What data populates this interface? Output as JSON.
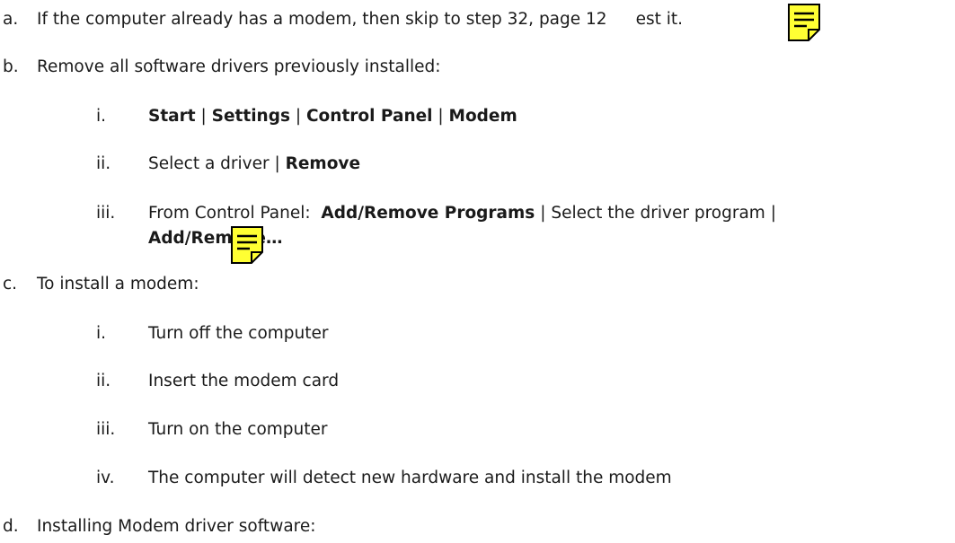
{
  "items": {
    "a": {
      "marker": "a.",
      "text_before": "If the computer already has a modem, then skip to step 32, page 12",
      "text_after": "est it."
    },
    "b": {
      "marker": "b.",
      "text": "Remove all software drivers previously installed:",
      "sub": {
        "i": {
          "marker": "i.",
          "start": "Start",
          "sep": "|",
          "settings": "Settings",
          "control_panel": "Control Panel",
          "modem": "Modem"
        },
        "ii": {
          "marker": "ii.",
          "text": "Select a driver",
          "sep": "|",
          "remove": "Remove"
        },
        "iii": {
          "marker": "iii.",
          "prefix": "From Control Panel:",
          "add_remove_programs": "Add/Remove Programs",
          "sep": "|",
          "select_text": "Select the driver program",
          "add_remove": "Add/Remove…"
        }
      }
    },
    "c": {
      "marker": "c.",
      "text": "To install a modem:",
      "sub": [
        {
          "marker": "i.",
          "text": "Turn off the computer"
        },
        {
          "marker": "ii.",
          "text": "Insert the modem card"
        },
        {
          "marker": "iii.",
          "text": "Turn on the computer"
        },
        {
          "marker": "iv.",
          "text": "The computer will detect new hardware and install the modem"
        }
      ]
    },
    "d": {
      "marker": "d.",
      "text": "Installing Modem driver software:"
    }
  },
  "icons": {
    "note_color": "#ffff33",
    "note_icon": "sticky-note-icon"
  }
}
